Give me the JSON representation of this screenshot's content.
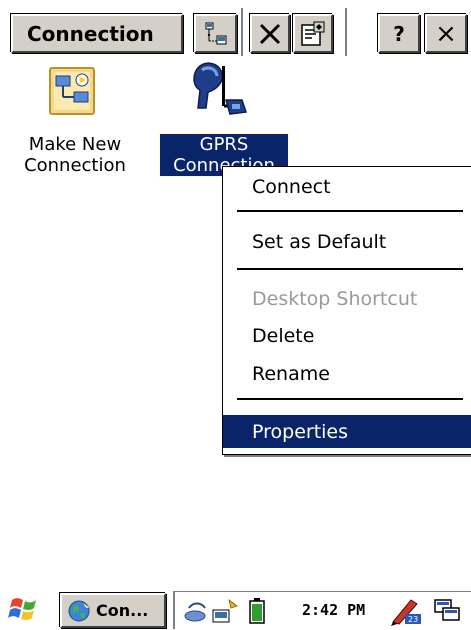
{
  "toolbar": {
    "title_label": "Connection",
    "help_label": "?",
    "close_label": "×",
    "icons": [
      "connection-settings-icon",
      "delete-x-icon",
      "properties-icon",
      "help-icon",
      "close-icon"
    ]
  },
  "desktop": {
    "items": [
      {
        "label_line1": "Make New",
        "label_line2": "Connection",
        "icon": "make-new-connection-icon",
        "selected": false
      },
      {
        "label_line1": "GPRS",
        "label_line2": "Connection",
        "icon": "gprs-connection-icon",
        "selected": true
      }
    ]
  },
  "context_menu": {
    "items": [
      {
        "label": "Connect",
        "state": "normal"
      },
      {
        "label": "Set as Default",
        "state": "normal"
      },
      {
        "label": "Desktop Shortcut",
        "state": "disabled"
      },
      {
        "label": "Delete",
        "state": "normal"
      },
      {
        "label": "Rename",
        "state": "normal"
      },
      {
        "label": "Properties",
        "state": "highlighted"
      }
    ]
  },
  "taskbar": {
    "start_icon": "windows-flag-icon",
    "task_label": "Con...",
    "task_icon": "connection-globe-icon",
    "clock": "2:42 PM",
    "tray_icons": [
      "network-icon",
      "battery-icon",
      "input-panel-icon",
      "desktop-icon"
    ]
  },
  "colors": {
    "selection": "#0a246a",
    "button_face": "#d4d0c8",
    "disabled_text": "#9a9a9a"
  }
}
